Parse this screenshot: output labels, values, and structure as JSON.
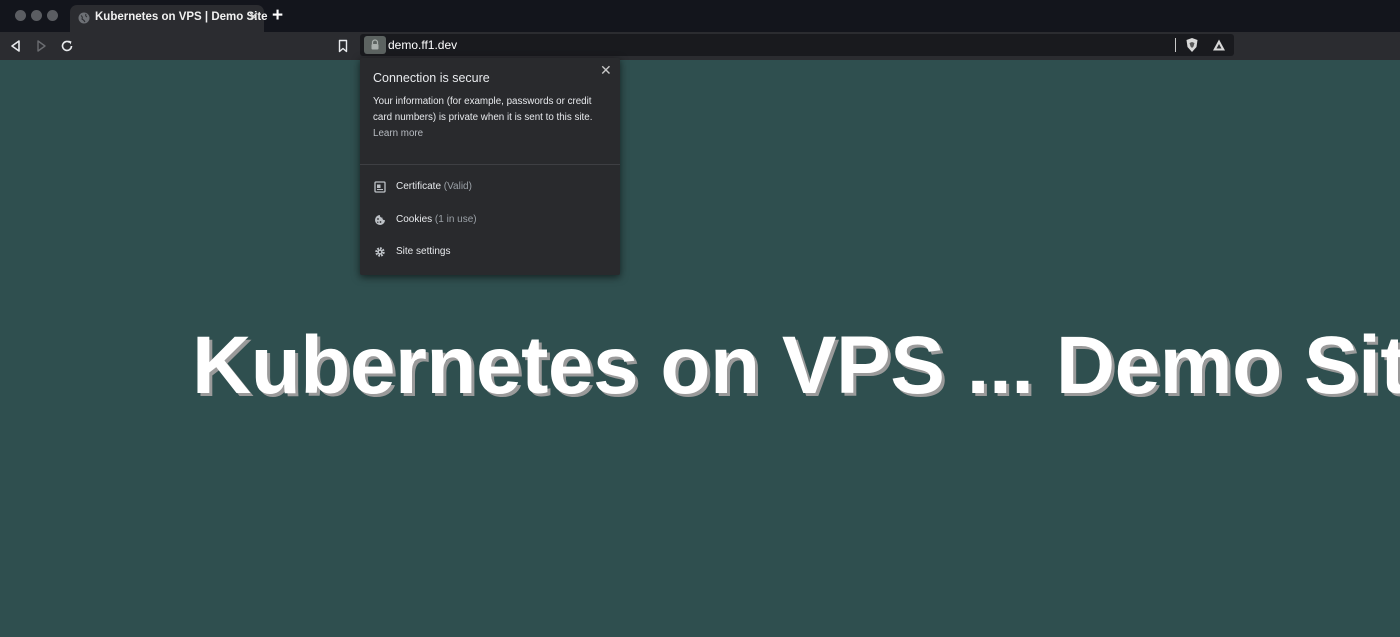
{
  "tab": {
    "title": "Kubernetes on VPS | Demo Site",
    "close": "✕",
    "new_tab": "+"
  },
  "address": {
    "url": "demo.ff1.dev"
  },
  "site_info": {
    "title": "Connection is secure",
    "close": "✕",
    "description": "Your information (for example, passwords or credit card numbers) is private when it is sent to this site.",
    "learn_more": "Learn more",
    "items": [
      {
        "label": "Certificate",
        "detail": "(Valid)",
        "icon": "certificate-icon"
      },
      {
        "label": "Cookies",
        "detail": "(1 in use)",
        "icon": "cookie-icon"
      },
      {
        "label": "Site settings",
        "detail": "",
        "icon": "gear-icon"
      }
    ]
  },
  "page": {
    "heading": "Kubernetes on VPS ... Demo Site"
  },
  "colors": {
    "page_background": "#2f4f4f",
    "titlebar": "#13151c",
    "toolbar": "#2b2c30",
    "popup": "#292a2d"
  }
}
